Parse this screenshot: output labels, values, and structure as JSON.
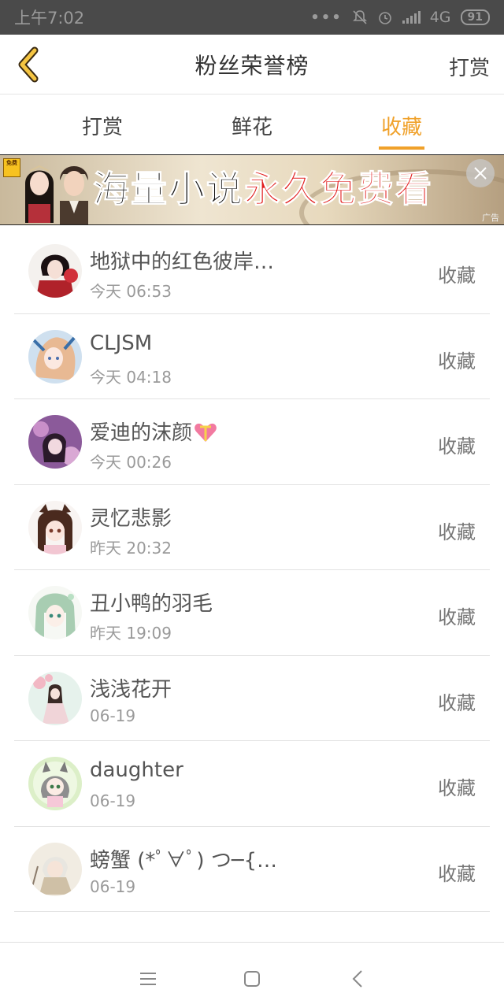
{
  "status_bar": {
    "time": "上午7:02",
    "network": "4G",
    "battery": "91"
  },
  "header": {
    "title": "粉丝荣誉榜",
    "reward_label": "打赏"
  },
  "tabs": [
    {
      "label": "打赏"
    },
    {
      "label": "鲜花"
    },
    {
      "label": "收藏"
    }
  ],
  "active_tab": "收藏",
  "banner": {
    "badge_text": "免费",
    "text_part1": "海量小说",
    "text_part2": "永久免费看",
    "ad_label": "广告"
  },
  "fans": [
    {
      "name": "地狱中的红色彼岸…",
      "time": "今天 06:53",
      "action": "收藏",
      "avatar": "anime-boy-red"
    },
    {
      "name": "CLJSM",
      "time": "今天 04:18",
      "action": "收藏",
      "avatar": "anime-girl-blue"
    },
    {
      "name": "爱迪的沫颜",
      "time": "今天 00:26",
      "action": "收藏",
      "avatar": "girl-purple",
      "emoji": "heart-gift-icon"
    },
    {
      "name": "灵忆悲影",
      "time": "昨天 20:32",
      "action": "收藏",
      "avatar": "anime-girl-cat"
    },
    {
      "name": "丑小鸭的羽毛",
      "time": "昨天 19:09",
      "action": "收藏",
      "avatar": "anime-girl-green"
    },
    {
      "name": "浅浅花开",
      "time": "06-19",
      "action": "收藏",
      "avatar": "ancient-lady"
    },
    {
      "name": "daughter",
      "time": "06-19",
      "action": "收藏",
      "avatar": "chibi-cat-girl"
    },
    {
      "name": "螃蟹 (*ﾟ∀ﾟ) つ─{…",
      "time": "06-19",
      "action": "收藏",
      "avatar": "anime-boy-white"
    }
  ],
  "colors": {
    "accent": "#f0a12a",
    "status_bar": "#4a4a4a",
    "text": "#555555",
    "subtext": "#9a9a9a"
  }
}
